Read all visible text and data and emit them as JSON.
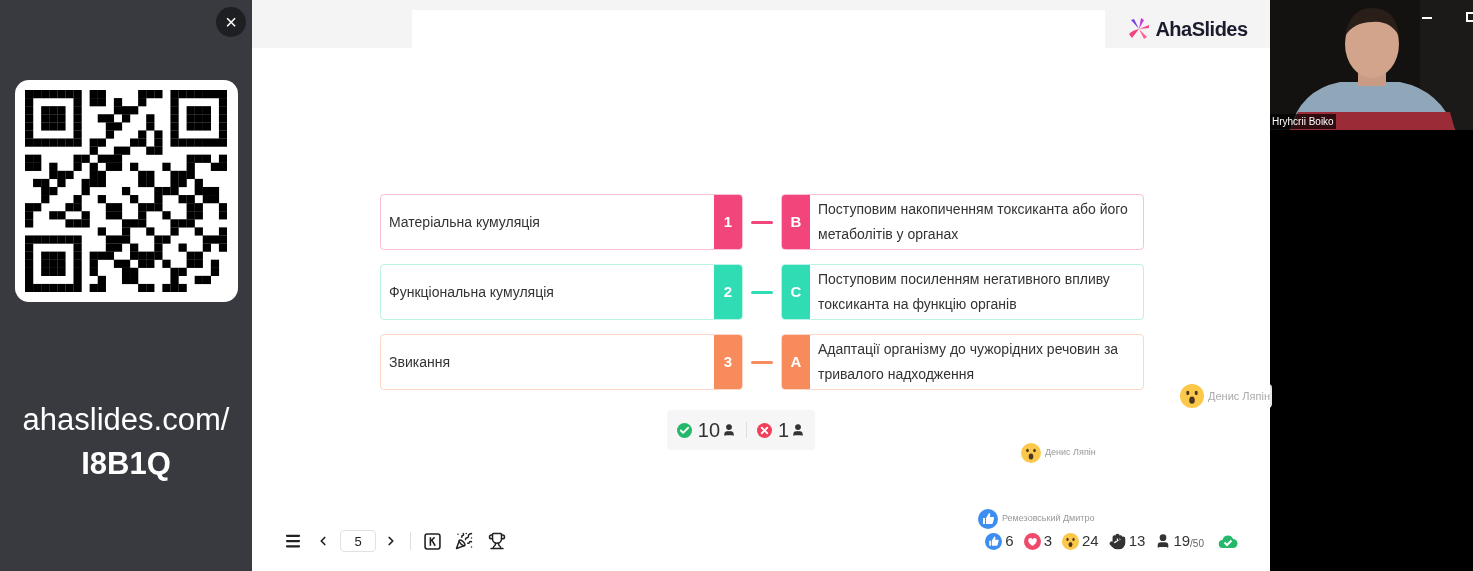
{
  "sidebar": {
    "close": "×",
    "url_line1": "ahaslides.com/",
    "url_line2": "I8B1Q"
  },
  "header": {
    "logo": "AhaSlides"
  },
  "pairs": [
    {
      "left": "Матеріальна кумуляція",
      "number": "1",
      "letter": "B",
      "right": "Поступовим накопиченням токсиканта або його метаболітів у органах",
      "color": "#f2457c"
    },
    {
      "left": "Функціональна кумуляція",
      "number": "2",
      "letter": "C",
      "right": "Поступовим посиленням негативного впливу токсиканта на функцію органів",
      "color": "#2fdcb3"
    },
    {
      "left": "Звикання",
      "number": "3",
      "letter": "A",
      "right": "Адаптації організму до чужорідних речовин за тривалого надходження",
      "color": "#f88b5c",
      "reaction": {
        "kind": "wow",
        "name": "Денис Ляпін"
      }
    }
  ],
  "results": {
    "correct": "10",
    "incorrect": "1"
  },
  "floating_reactions": [
    {
      "kind": "wow",
      "name": "Денис Ляпін"
    },
    {
      "kind": "like",
      "name": "Ремезовський Дмитро"
    }
  ],
  "toolbar": {
    "slide": "5"
  },
  "stats": [
    {
      "kind": "like",
      "count": "6"
    },
    {
      "kind": "heart",
      "count": "3"
    },
    {
      "kind": "wow",
      "count": "24"
    },
    {
      "kind": "hand",
      "count": "13"
    }
  ],
  "audience": {
    "count": "19",
    "max": "/50"
  },
  "video": {
    "name": "Hryhcrii Boiko"
  }
}
